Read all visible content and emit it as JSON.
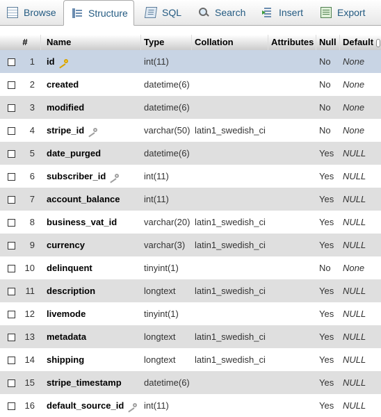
{
  "tabs": [
    {
      "label": "Browse",
      "icon": "browse-icon",
      "active": false
    },
    {
      "label": "Structure",
      "icon": "structure-icon",
      "active": true
    },
    {
      "label": "SQL",
      "icon": "sql-icon",
      "active": false
    },
    {
      "label": "Search",
      "icon": "search-icon",
      "active": false
    },
    {
      "label": "Insert",
      "icon": "insert-icon",
      "active": false
    },
    {
      "label": "Export",
      "icon": "export-icon",
      "active": false
    }
  ],
  "table": {
    "headers": {
      "num": "#",
      "name": "Name",
      "type": "Type",
      "collation": "Collation",
      "attributes": "Attributes",
      "null": "Null",
      "default": "Default"
    },
    "rows": [
      {
        "num": "1",
        "name": "id",
        "key": "primary",
        "type": "int(11)",
        "collation": "",
        "null": "No",
        "default": "None"
      },
      {
        "num": "2",
        "name": "created",
        "key": "",
        "type": "datetime(6)",
        "collation": "",
        "null": "No",
        "default": "None"
      },
      {
        "num": "3",
        "name": "modified",
        "key": "",
        "type": "datetime(6)",
        "collation": "",
        "null": "No",
        "default": "None"
      },
      {
        "num": "4",
        "name": "stripe_id",
        "key": "index",
        "type": "varchar(50)",
        "collation": "latin1_swedish_ci",
        "null": "No",
        "default": "None"
      },
      {
        "num": "5",
        "name": "date_purged",
        "key": "",
        "type": "datetime(6)",
        "collation": "",
        "null": "Yes",
        "default": "NULL"
      },
      {
        "num": "6",
        "name": "subscriber_id",
        "key": "index",
        "type": "int(11)",
        "collation": "",
        "null": "Yes",
        "default": "NULL"
      },
      {
        "num": "7",
        "name": "account_balance",
        "key": "",
        "type": "int(11)",
        "collation": "",
        "null": "Yes",
        "default": "NULL"
      },
      {
        "num": "8",
        "name": "business_vat_id",
        "key": "",
        "type": "varchar(20)",
        "collation": "latin1_swedish_ci",
        "null": "Yes",
        "default": "NULL"
      },
      {
        "num": "9",
        "name": "currency",
        "key": "",
        "type": "varchar(3)",
        "collation": "latin1_swedish_ci",
        "null": "Yes",
        "default": "NULL"
      },
      {
        "num": "10",
        "name": "delinquent",
        "key": "",
        "type": "tinyint(1)",
        "collation": "",
        "null": "No",
        "default": "None"
      },
      {
        "num": "11",
        "name": "description",
        "key": "",
        "type": "longtext",
        "collation": "latin1_swedish_ci",
        "null": "Yes",
        "default": "NULL"
      },
      {
        "num": "12",
        "name": "livemode",
        "key": "",
        "type": "tinyint(1)",
        "collation": "",
        "null": "Yes",
        "default": "NULL"
      },
      {
        "num": "13",
        "name": "metadata",
        "key": "",
        "type": "longtext",
        "collation": "latin1_swedish_ci",
        "null": "Yes",
        "default": "NULL"
      },
      {
        "num": "14",
        "name": "shipping",
        "key": "",
        "type": "longtext",
        "collation": "latin1_swedish_ci",
        "null": "Yes",
        "default": "NULL"
      },
      {
        "num": "15",
        "name": "stripe_timestamp",
        "key": "",
        "type": "datetime(6)",
        "collation": "",
        "null": "Yes",
        "default": "NULL"
      },
      {
        "num": "16",
        "name": "default_source_id",
        "key": "index",
        "type": "int(11)",
        "collation": "",
        "null": "Yes",
        "default": "NULL"
      }
    ]
  },
  "colors": {
    "tab_text": "#235a81",
    "row_alt": "#dfdfdf",
    "row_highlight": "#c8d4e4"
  }
}
